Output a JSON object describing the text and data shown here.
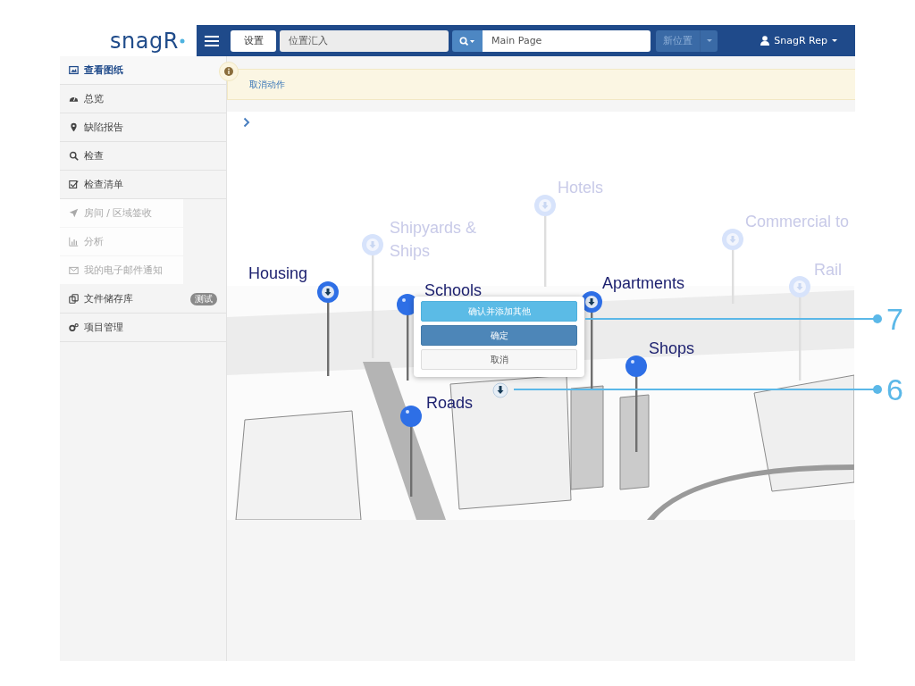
{
  "logo": "snagR",
  "toolbar": {
    "settings_button": "设置",
    "location_field": {
      "value": "位置汇入"
    },
    "search_field": {
      "value": "Main Page"
    },
    "new_location_button": {
      "label": "新位置",
      "disabled": true
    },
    "user_menu": "SnagR Rep"
  },
  "sidebar": {
    "items": [
      {
        "label": "查看图纸",
        "selected": true,
        "dimmed": false
      },
      {
        "label": "总览",
        "selected": false,
        "dimmed": false
      },
      {
        "label": "缺陷报告",
        "selected": false,
        "dimmed": false
      },
      {
        "label": "检查",
        "selected": false,
        "dimmed": false
      },
      {
        "label": "检查清单",
        "selected": false,
        "dimmed": false
      },
      {
        "label": "房间 / 区域签收",
        "selected": false,
        "dimmed": true
      },
      {
        "label": "分析",
        "selected": false,
        "dimmed": true
      },
      {
        "label": "我的电子邮件通知",
        "selected": false,
        "dimmed": true
      },
      {
        "label": "文件储存库",
        "selected": false,
        "dimmed": false,
        "badge": "测试"
      },
      {
        "label": "项目管理",
        "selected": false,
        "dimmed": false
      }
    ]
  },
  "alert": {
    "link": "取消动作"
  },
  "drawing": {
    "pins": [
      {
        "label": "Housing",
        "kind": "icon",
        "faded": false
      },
      {
        "label": "Shipyards & Ships",
        "kind": "icon",
        "faded": true
      },
      {
        "label": "Hotels",
        "kind": "icon",
        "faded": true
      },
      {
        "label": "Schools",
        "kind": "plain",
        "faded": false
      },
      {
        "label": "Apartments",
        "kind": "icon",
        "faded": false
      },
      {
        "label": "Commercial to",
        "kind": "icon",
        "faded": true
      },
      {
        "label": "Rail",
        "kind": "icon",
        "faded": true
      },
      {
        "label": "Shops",
        "kind": "plain",
        "faded": false
      },
      {
        "label": "Roads",
        "kind": "plain",
        "faded": false
      }
    ],
    "popup": {
      "buttons": [
        {
          "label": "确认并添加其他",
          "kind": "info"
        },
        {
          "label": "确定",
          "kind": "primary"
        },
        {
          "label": "取消",
          "kind": "default"
        }
      ]
    }
  },
  "callouts": [
    {
      "number": "7"
    },
    {
      "number": "6"
    }
  ]
}
